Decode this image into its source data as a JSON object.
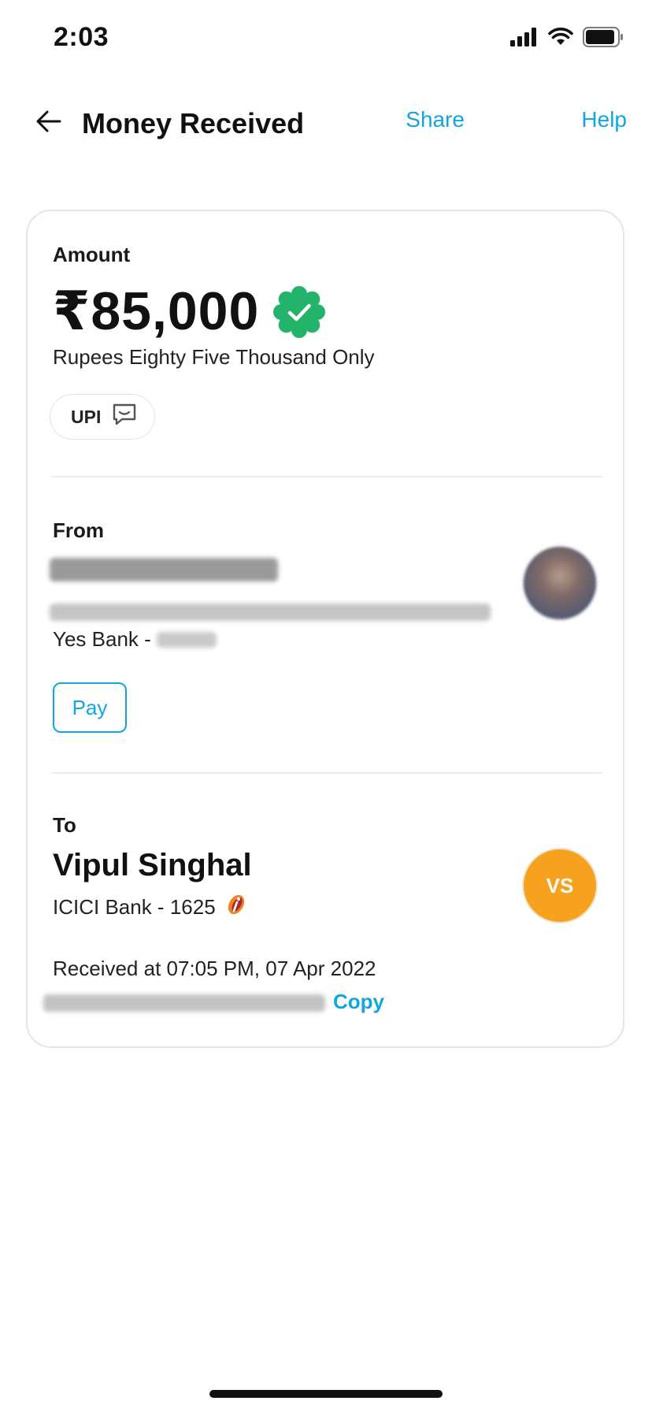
{
  "status_bar": {
    "time": "2:03",
    "icons": [
      "signal-icon",
      "wifi-icon",
      "battery-icon"
    ]
  },
  "header": {
    "back_icon": "arrow-left-icon",
    "title": "Money Received",
    "share_label": "Share",
    "help_label": "Help"
  },
  "amount_section": {
    "label": "Amount",
    "value": "₹85,000",
    "verified_icon": "verified-badge-icon",
    "words": "Rupees Eighty Five Thousand Only",
    "method_label": "UPI",
    "method_icon": "chat-bubble-icon"
  },
  "from_section": {
    "label": "From",
    "bank_prefix": "Yes Bank - ",
    "pay_label": "Pay"
  },
  "to_section": {
    "label": "To",
    "name": "Vipul Singhal",
    "bank": "ICICI Bank - 1625",
    "bank_logo_icon": "icici-logo-icon",
    "initials": "VS"
  },
  "transaction": {
    "received_at": "Received at 07:05 PM, 07 Apr 2022",
    "copy_label": "Copy"
  },
  "colors": {
    "accent": "#12a6e0",
    "verified": "#23b36a",
    "avatar_bg": "#f7a21e",
    "card_border": "#dfe7ee"
  }
}
